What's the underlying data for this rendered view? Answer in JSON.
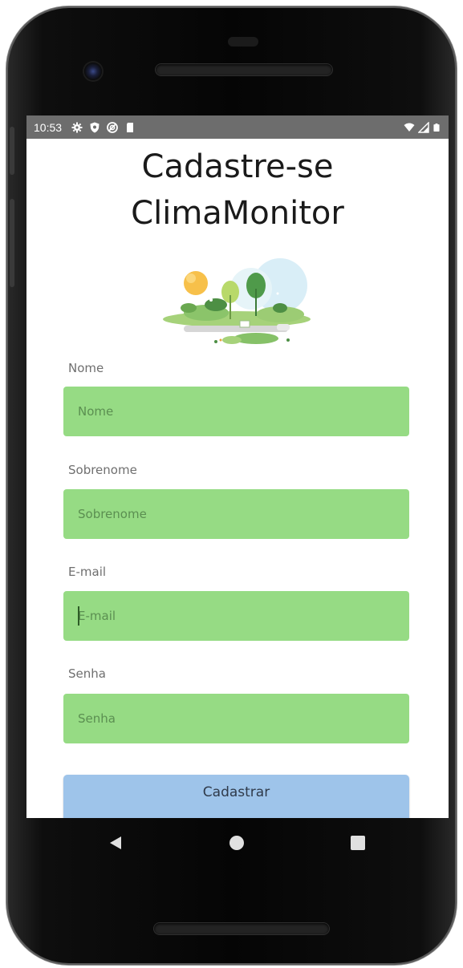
{
  "status_bar": {
    "time": "10:53",
    "left_icons": [
      "settings-icon",
      "shield-icon",
      "sync-icon",
      "sd-card-icon"
    ],
    "right_icons": [
      "wifi-icon",
      "signal-icon",
      "battery-icon"
    ]
  },
  "title": {
    "line1": "Cadastre-se",
    "line2": "ClimaMonitor"
  },
  "form": {
    "nome_label": "Nome",
    "nome_placeholder": "Nome",
    "sobrenome_label": "Sobrenome",
    "sobrenome_placeholder": "Sobrenome",
    "email_label": "E-mail",
    "email_placeholder": "E-mail",
    "senha_label": "Senha",
    "senha_placeholder": "Senha",
    "submit_label": "Cadastrar"
  },
  "colors": {
    "field_bg": "#96db84",
    "button_bg": "#9ec4ea",
    "status_bar_bg": "#6d6d6d"
  },
  "nav": {
    "icons": [
      "back-icon",
      "home-icon",
      "recents-icon"
    ]
  }
}
